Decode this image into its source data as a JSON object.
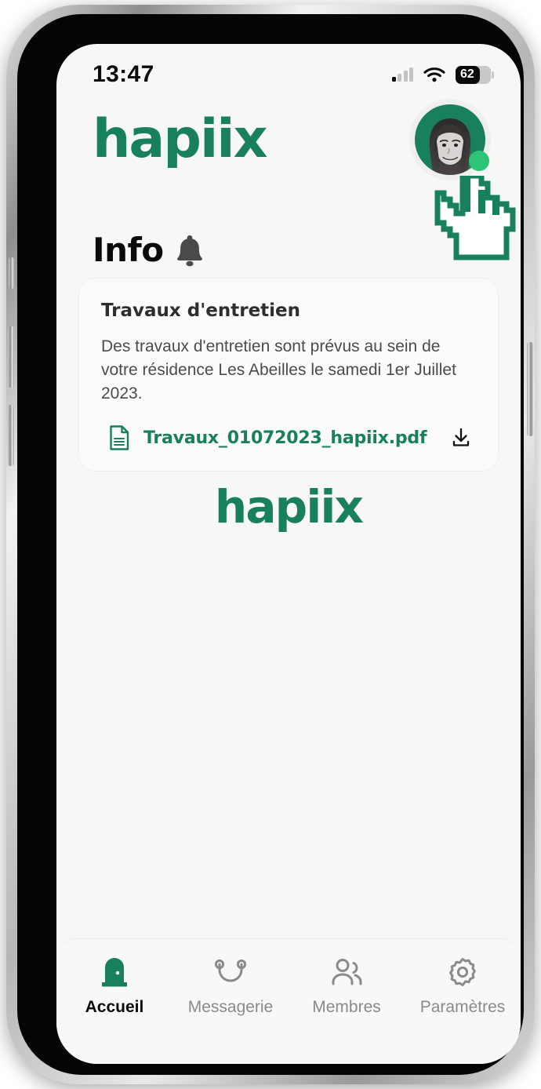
{
  "brand": {
    "name": "hapiix",
    "color": "#18805a"
  },
  "status_bar": {
    "time": "13:47",
    "battery_percent": "62",
    "signal_icon": "cellular-bars-icon",
    "wifi_icon": "wifi-icon",
    "battery_icon": "battery-icon"
  },
  "header": {
    "logo_text": "hapiix",
    "avatar_name": "avatar",
    "online_dot": "#2dc478",
    "cursor_icon": "pointing-hand-cursor-icon"
  },
  "section": {
    "title": "Info",
    "bell_icon": "bell-icon"
  },
  "card": {
    "title": "Travaux d'entretien",
    "body": "Des travaux d'entretien sont prévus au sein de votre résidence Les Abeilles le samedi 1er Juillet 2023.",
    "attachment": {
      "file_icon": "document-icon",
      "filename": "Travaux_01072023_hapiix.pdf",
      "download_icon": "download-icon"
    }
  },
  "watermark": {
    "text": "hapiix"
  },
  "tabbar": {
    "items": [
      {
        "label": "Accueil",
        "icon": "door-icon",
        "active": true
      },
      {
        "label": "Messagerie",
        "icon": "chat-icon",
        "active": false
      },
      {
        "label": "Membres",
        "icon": "people-icon",
        "active": false
      },
      {
        "label": "Paramètres",
        "icon": "gear-icon",
        "active": false
      }
    ]
  }
}
